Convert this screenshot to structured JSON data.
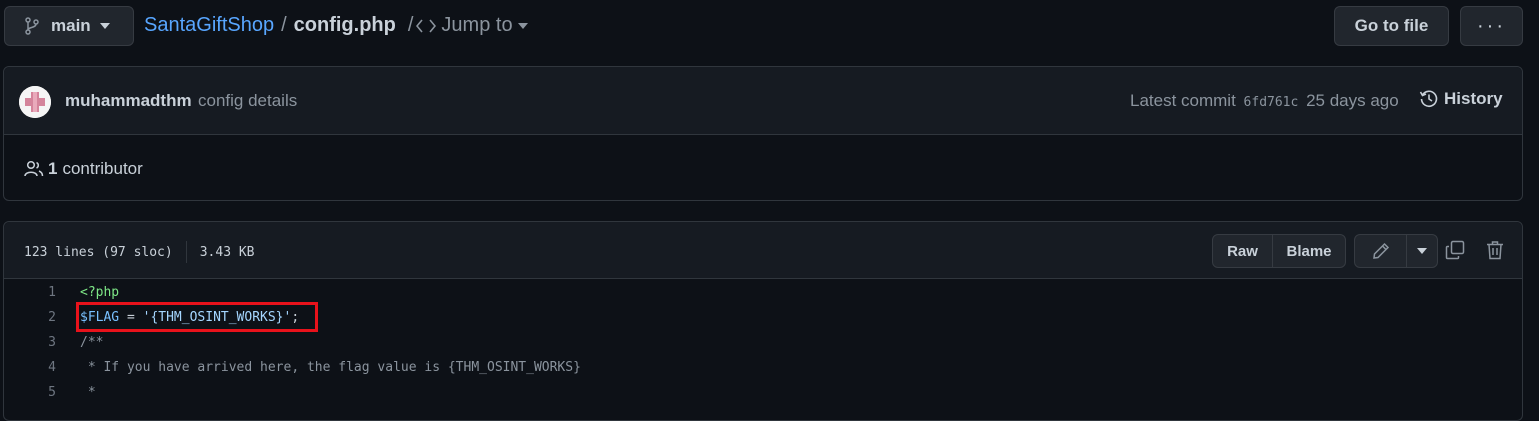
{
  "topbar": {
    "branch": "main",
    "repo": "SantaGiftShop",
    "separator": "/",
    "file": "config.php",
    "jump_sep": "/",
    "jump_to": "Jump to",
    "go_to_file": "Go to file",
    "more": "···"
  },
  "commit": {
    "author": "muhammadthm",
    "message": "config details",
    "latest_label": "Latest commit",
    "sha": "6fd761c",
    "age": "25 days ago",
    "history": "History",
    "contributor_count": "1",
    "contributor_label": "contributor"
  },
  "file": {
    "lines_info": "123 lines (97 sloc)",
    "size": "3.43 KB",
    "raw": "Raw",
    "blame": "Blame"
  },
  "code": {
    "lines": [
      {
        "num": "1",
        "parts": [
          {
            "cls": "tok-tag",
            "text": "<?php"
          }
        ]
      },
      {
        "num": "2",
        "parts": [
          {
            "cls": "tok-var",
            "text": "$FLAG"
          },
          {
            "cls": "",
            "text": " = "
          },
          {
            "cls": "tok-str",
            "text": "'{THM_OSINT_WORKS}'"
          },
          {
            "cls": "",
            "text": ";"
          }
        ]
      },
      {
        "num": "3",
        "parts": [
          {
            "cls": "tok-comment",
            "text": "/**"
          }
        ]
      },
      {
        "num": "4",
        "parts": [
          {
            "cls": "tok-comment",
            "text": " * If you have arrived here, the flag value is {THM_OSINT_WORKS}"
          }
        ]
      },
      {
        "num": "5",
        "parts": [
          {
            "cls": "tok-comment",
            "text": " *"
          }
        ]
      }
    ]
  },
  "colors": {
    "background": "#0d1117",
    "link": "#58a6ff",
    "highlight_border": "#e8121b"
  }
}
